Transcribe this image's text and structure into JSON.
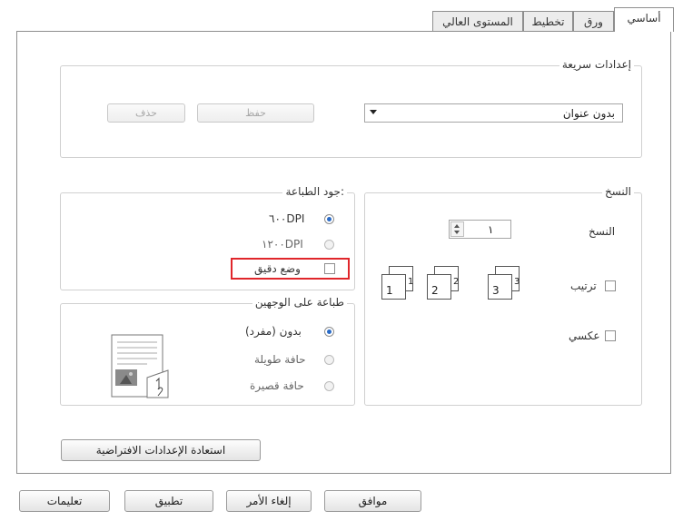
{
  "tabs": [
    "أساسي",
    "ورق",
    "تخطيط",
    "المستوى العالي"
  ],
  "quick_settings": {
    "legend": "إعدادات سريعة",
    "selected": "بدون عنوان",
    "save_label": "حفظ",
    "delete_label": "حذف"
  },
  "quality": {
    "legend": "جود الطباعة:",
    "option_600": "٦٠٠DPI",
    "option_1200": "١٢٠٠DPI",
    "fine_mode": "وضع دقيق"
  },
  "duplex": {
    "legend": "طباعة على الوجهين",
    "none": "بدون (مفرد)",
    "long_edge": "حافة طويلة",
    "short_edge": "حافة قصيرة"
  },
  "copies": {
    "legend": "النسخ",
    "label": "النسخ",
    "value": "١",
    "collate": "ترتيب",
    "reverse": "عكسي",
    "page_numbers": [
      "1",
      "2",
      "3"
    ]
  },
  "restore_defaults": "استعادة الإعدادات الافتراضية",
  "footer": {
    "ok": "موافق",
    "cancel": "إلغاء الأمر",
    "apply": "تطبيق",
    "help": "تعليمات"
  },
  "colors": {
    "highlight": "#e0262b",
    "radio_selected": "#2a6bc7"
  }
}
